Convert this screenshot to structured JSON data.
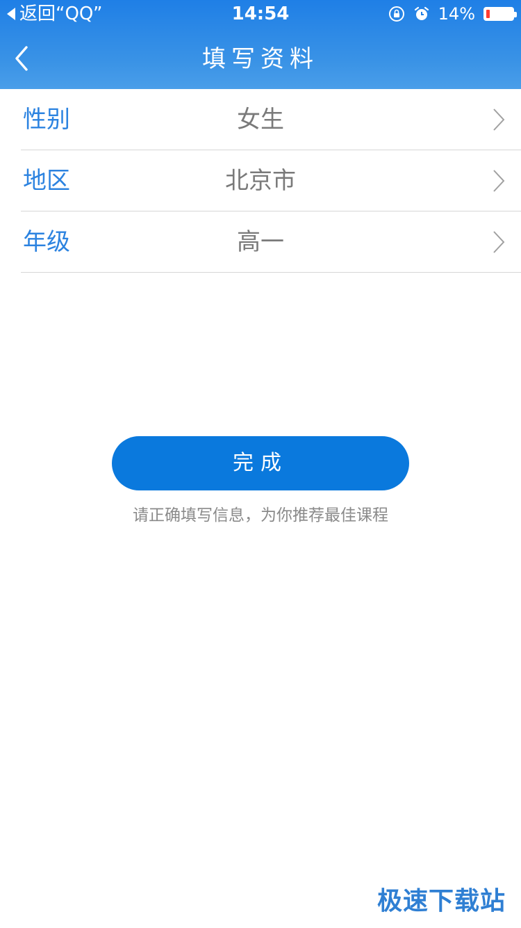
{
  "status_bar": {
    "back_text": "返回“QQ”",
    "time": "14:54",
    "battery_percent": "14%",
    "battery_level": 0.14,
    "icons": [
      "orientation-lock-icon",
      "alarm-icon",
      "battery-icon"
    ]
  },
  "nav": {
    "title": "填写资料",
    "back_icon": "chevron-left-icon"
  },
  "form": {
    "rows": [
      {
        "label": "性别",
        "value": "女生"
      },
      {
        "label": "地区",
        "value": "北京市"
      },
      {
        "label": "年级",
        "value": "高一"
      }
    ]
  },
  "submit": {
    "label": "完成",
    "hint": "请正确填写信息，为你推荐最佳课程"
  },
  "watermark": "极速下载站",
  "colors": {
    "header_gradient_top": "#1f7fe6",
    "header_gradient_bottom": "#4a9ee9",
    "label_blue": "#2c83e0",
    "button_blue": "#0a79dd",
    "value_gray": "#7a7a7a",
    "battery_red": "#ff3b30"
  }
}
